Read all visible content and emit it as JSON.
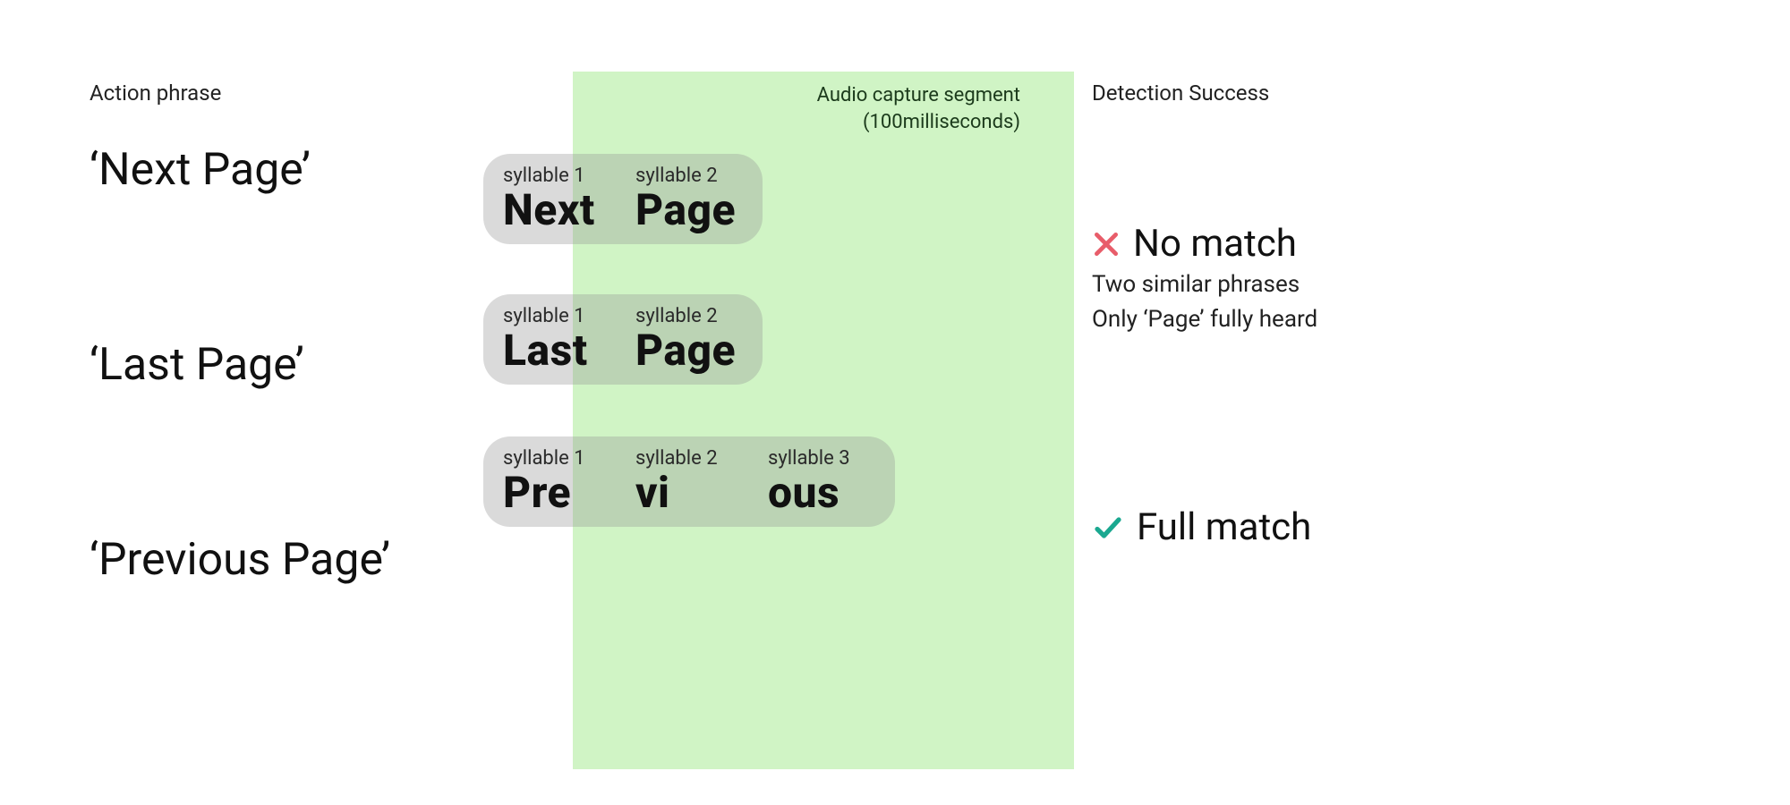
{
  "headings": {
    "action_phrase": "Action phrase",
    "detection_success": "Detection Success"
  },
  "capture": {
    "title": "Audio capture segment",
    "subtitle": "(100milliseconds)"
  },
  "phrases": {
    "next": "‘Next Page’",
    "last": "‘Last Page’",
    "previous": "‘Previous Page’"
  },
  "syllable_labels": {
    "s1": "syllable 1",
    "s2": "syllable 2",
    "s3": "syllable 3"
  },
  "syllables": {
    "next": {
      "a": "Next",
      "b": "Page"
    },
    "last": {
      "a": "Last",
      "b": "Page"
    },
    "previous": {
      "a": "Pre",
      "b": "vi",
      "c": "ous"
    }
  },
  "results": {
    "no_match": {
      "title": "No match",
      "line1": "Two similar phrases",
      "line2": "Only ‘Page’ fully heard"
    },
    "full_match": {
      "title": "Full match"
    }
  },
  "colors": {
    "capture_bg": "#c7f2b2",
    "x_icon": "#e85d6a",
    "check_icon": "#1aa890"
  }
}
